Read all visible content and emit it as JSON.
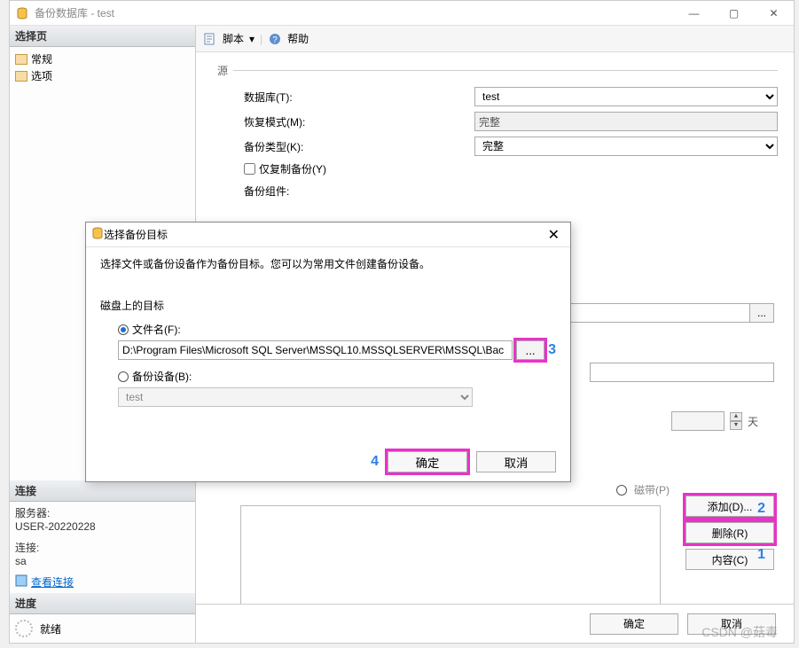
{
  "window": {
    "title": "备份数据库 - test"
  },
  "sidebar": {
    "select_header": "选择页",
    "items": [
      {
        "label": "常规"
      },
      {
        "label": "选项"
      }
    ],
    "conn_header": "连接",
    "server_label": "服务器:",
    "server_value": "USER-20220228",
    "conn_label": "连接:",
    "conn_value": "sa",
    "view_conn": "查看连接",
    "progress_header": "进度",
    "progress_status": "就绪"
  },
  "toolbar": {
    "script": "脚本",
    "help": "帮助"
  },
  "form": {
    "group_source": "源",
    "database_label": "数据库(T):",
    "database_value": "test",
    "recovery_label": "恢复模式(M):",
    "recovery_value": "完整",
    "backup_type_label": "备份类型(K):",
    "backup_type_value": "完整",
    "copy_only": "仅复制备份(Y)",
    "backup_component": "备份组件:",
    "days_label": "天",
    "tape_label": "磁带(P)"
  },
  "buttons": {
    "add": "添加(D)...",
    "remove": "删除(R)",
    "content": "内容(C)",
    "ok": "确定",
    "cancel": "取消"
  },
  "modal": {
    "title": "选择备份目标",
    "desc": "选择文件或备份设备作为备份目标。您可以为常用文件创建备份设备。",
    "section": "磁盘上的目标",
    "file_radio": "文件名(F):",
    "file_path": "D:\\Program Files\\Microsoft SQL Server\\MSSQL10.MSSQLSERVER\\MSSQL\\Bac",
    "device_radio": "备份设备(B):",
    "device_value": "test",
    "ok": "确定",
    "cancel": "取消",
    "browse_label": "..."
  },
  "annotations": {
    "n1": "1",
    "n2": "2",
    "n3": "3",
    "n4": "4"
  },
  "watermark": "CSDN @菇毒"
}
